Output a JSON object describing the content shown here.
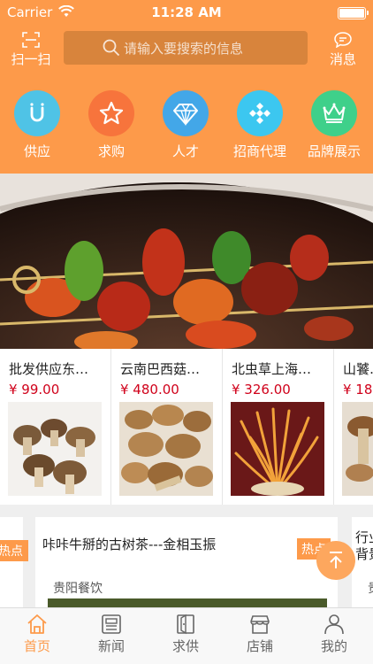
{
  "status_bar": {
    "carrier": "Carrier",
    "time": "11:28 AM"
  },
  "header": {
    "scan_label": "扫一扫",
    "search_placeholder": "请输入要搜索的信息",
    "message_label": "消息"
  },
  "categories": [
    {
      "label": "供应",
      "icon": "u-icon",
      "color": "#4fc3e6"
    },
    {
      "label": "求购",
      "icon": "star-icon",
      "color": "#f7743c"
    },
    {
      "label": "人才",
      "icon": "diamond-icon",
      "color": "#43a7e8"
    },
    {
      "label": "招商代理",
      "icon": "grid-diamond-icon",
      "color": "#3cc7f0"
    },
    {
      "label": "品牌展示",
      "icon": "crown-icon",
      "color": "#3fd08a"
    }
  ],
  "products": [
    {
      "name": "批发供应东…",
      "price": "¥ 99.00"
    },
    {
      "name": "云南巴西菇…",
      "price": "¥ 480.00"
    },
    {
      "name": "北虫草上海…",
      "price": "¥ 326.00"
    },
    {
      "name": "山饕…",
      "price": "¥ 18"
    }
  ],
  "news": {
    "left_tag": "热点",
    "main": {
      "title": "咔咔牛掰的古树茶---金相玉振",
      "tag": "热点",
      "subtitle": "贵阳餐饮"
    },
    "right": {
      "title": "行业背景",
      "subtitle": "贵"
    }
  },
  "tabs": [
    {
      "label": "首页",
      "active": true
    },
    {
      "label": "新闻",
      "active": false
    },
    {
      "label": "求供",
      "active": false
    },
    {
      "label": "店铺",
      "active": false
    },
    {
      "label": "我的",
      "active": false
    }
  ],
  "colors": {
    "brand": "#fd9a4a",
    "price": "#d0021b"
  }
}
